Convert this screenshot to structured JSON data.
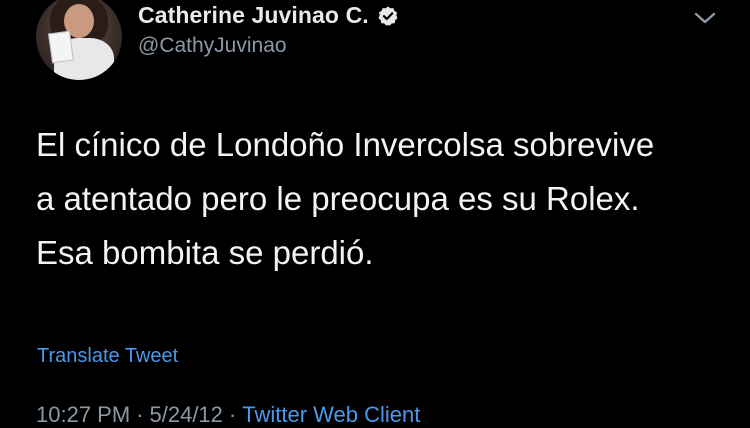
{
  "author": {
    "display_name": "Catherine Juvinao C.",
    "handle": "@CathyJuvinao",
    "verified": true
  },
  "tweet": {
    "lines": [
      "El cínico de Londoño Invercolsa sobrevive",
      "a atentado pero le preocupa es su Rolex.",
      "Esa bombita se perdió."
    ]
  },
  "actions": {
    "translate_label": "Translate Tweet",
    "menu_icon": "chevron-down-icon"
  },
  "meta": {
    "time": "10:27 PM",
    "date": "5/24/12",
    "separator": "·",
    "source": "Twitter Web Client"
  },
  "colors": {
    "background": "#000000",
    "text": "#e7e9ea",
    "secondary": "#8b98a5",
    "link": "#4a98ea"
  }
}
